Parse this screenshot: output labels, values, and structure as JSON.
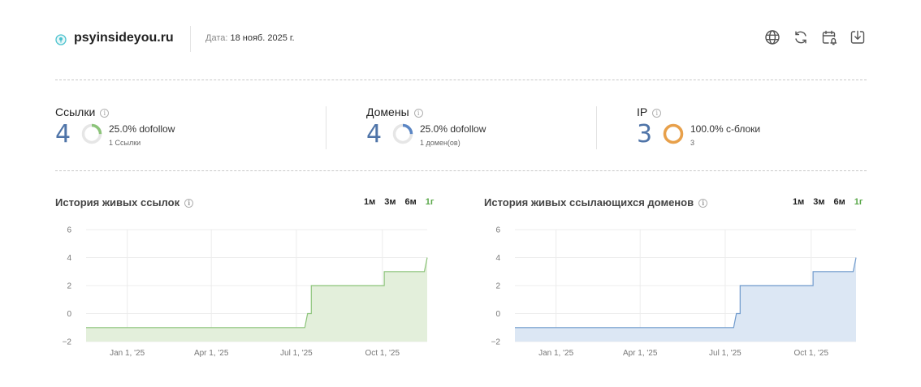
{
  "header": {
    "site": "psyinsideyou.ru",
    "date_label": "Дата:",
    "date_value": "18 нояб. 2025 г.",
    "icons": [
      "globe-icon",
      "refresh-icon",
      "calendar-bell-icon",
      "download-icon"
    ]
  },
  "stats": [
    {
      "title": "Ссылки",
      "value": "4",
      "percent_label": "25.0% dofollow",
      "sub": "1 Ссылки",
      "fraction": 0.25,
      "color": "#8cc47a"
    },
    {
      "title": "Домены",
      "value": "4",
      "percent_label": "25.0% dofollow",
      "sub": "1 домен(ов)",
      "fraction": 0.25,
      "color": "#5b86c4"
    },
    {
      "title": "IP",
      "value": "3",
      "percent_label": "100.0% c-блоки",
      "sub": "3",
      "fraction": 1.0,
      "color": "#e8a04a"
    }
  ],
  "colors": {
    "accent_green": "#5aa84a",
    "number_blue": "#4f74a8"
  },
  "ranges": [
    "1м",
    "3м",
    "6м",
    "1г"
  ],
  "active_range": "1г",
  "chart_data": [
    {
      "type": "area",
      "title": "История живых ссылок",
      "color": "#8cc47a",
      "fill": "#e3efdb",
      "ylim": [
        -2,
        6
      ],
      "yticks": [
        "6",
        "4",
        "2",
        "0",
        "−2"
      ],
      "xlim": [
        "2024-11-18",
        "2025-11-18"
      ],
      "xticks": [
        "Jan 1, '25",
        "Apr 1, '25",
        "Jul 1, '25",
        "Oct 1, '25"
      ],
      "grid": true,
      "x": [
        "2024-11-18",
        "2025-07-10",
        "2025-07-13",
        "2025-07-13",
        "2025-07-17",
        "2025-07-17",
        "2025-10-03",
        "2025-10-03",
        "2025-11-15",
        "2025-11-15",
        "2025-11-18"
      ],
      "y": [
        -1,
        -1,
        0,
        0,
        0,
        2,
        2,
        3,
        3,
        3,
        4
      ]
    },
    {
      "type": "area",
      "title": "История живых ссылающихся доменов",
      "color": "#6f9acc",
      "fill": "#dce7f4",
      "ylim": [
        -2,
        6
      ],
      "yticks": [
        "6",
        "4",
        "2",
        "0",
        "−2"
      ],
      "xlim": [
        "2024-11-18",
        "2025-11-18"
      ],
      "xticks": [
        "Jan 1, '25",
        "Apr 1, '25",
        "Jul 1, '25",
        "Oct 1, '25"
      ],
      "grid": true,
      "x": [
        "2024-11-18",
        "2025-07-10",
        "2025-07-13",
        "2025-07-13",
        "2025-07-17",
        "2025-07-17",
        "2025-10-03",
        "2025-10-03",
        "2025-11-15",
        "2025-11-15",
        "2025-11-18"
      ],
      "y": [
        -1,
        -1,
        0,
        0,
        0,
        2,
        2,
        3,
        3,
        3,
        4
      ]
    }
  ]
}
